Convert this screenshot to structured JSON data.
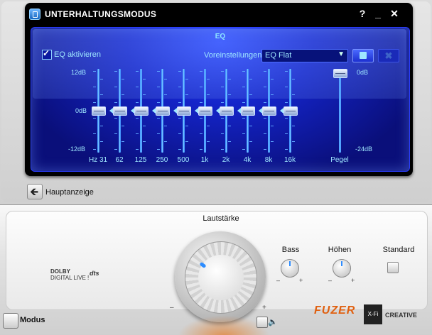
{
  "window": {
    "title": "UNTERHALTUNGSMODUS",
    "help": "?",
    "minimize": "_",
    "close": "✕"
  },
  "eq": {
    "title": "EQ",
    "enable_label": "EQ aktivieren",
    "enabled": true,
    "preset_label": "Voreinstellungen",
    "preset_value": "EQ Flat",
    "delete_label": "✖",
    "db_top": "12dB",
    "db_mid": "0dB",
    "db_bottom": "-12dB",
    "bands": [
      {
        "label": "Hz 31",
        "gain_db": 0
      },
      {
        "label": "62",
        "gain_db": 0
      },
      {
        "label": "125",
        "gain_db": 0
      },
      {
        "label": "250",
        "gain_db": 0
      },
      {
        "label": "500",
        "gain_db": 0
      },
      {
        "label": "1k",
        "gain_db": 0
      },
      {
        "label": "2k",
        "gain_db": 0
      },
      {
        "label": "4k",
        "gain_db": 0
      },
      {
        "label": "8k",
        "gain_db": 0
      },
      {
        "label": "16k",
        "gain_db": 0
      }
    ],
    "pegel": {
      "label": "Pegel",
      "top": "0dB",
      "bottom": "-24dB",
      "value_db": 0
    }
  },
  "nav": {
    "main_view_label": "Hauptanzeige",
    "arrow": "🡸"
  },
  "controls": {
    "volume_label": "Lautstärke",
    "bass_label": "Bass",
    "treble_label": "Höhen",
    "standard_label": "Standard",
    "minus": "–",
    "plus": "+",
    "speaker": "🔈"
  },
  "footer": {
    "modus_label": "Modus",
    "dolby_line1": "DOLBY",
    "dolby_line2": "DIGITAL LIVE !",
    "dts_text": "dts",
    "fuzer_text": "FUZER",
    "xfi_text": "X-Fi",
    "creative_text": "CREATIVE"
  }
}
